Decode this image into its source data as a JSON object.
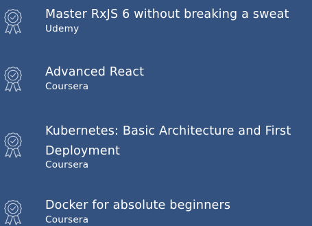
{
  "certifications": [
    {
      "title": "Master RxJS 6 without breaking a sweat",
      "provider": "Udemy",
      "icon": "award-ribbon-icon"
    },
    {
      "title": "Advanced React",
      "provider": "Coursera",
      "icon": "award-ribbon-icon"
    },
    {
      "title": "Kubernetes: Basic Architecture and First Deployment",
      "provider": "Coursera",
      "icon": "award-ribbon-icon"
    },
    {
      "title": "Docker for absolute beginners",
      "provider": "Coursera",
      "icon": "award-ribbon-icon"
    }
  ],
  "colors": {
    "background": "#33527f",
    "text": "#ffffff",
    "icon_stroke": "#c9d3e2"
  }
}
